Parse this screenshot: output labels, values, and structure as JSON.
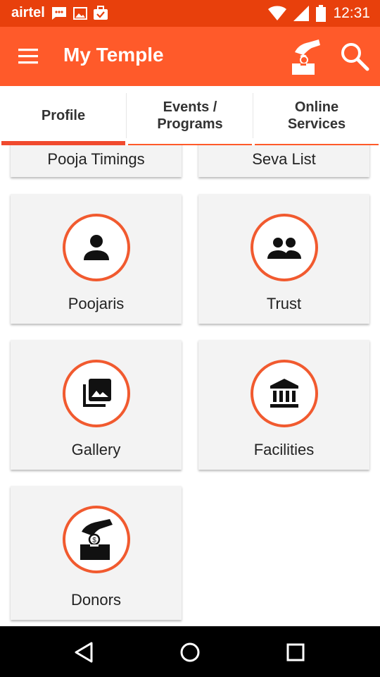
{
  "status_bar": {
    "carrier": "airtel",
    "time": "12:31",
    "icons": [
      "sms-icon",
      "image-icon",
      "briefcase-check-icon",
      "wifi-icon",
      "signal-icon",
      "battery-icon"
    ]
  },
  "app_bar": {
    "title": "My Temple",
    "icons": [
      "menu-icon",
      "donate-icon",
      "search-icon"
    ]
  },
  "tabs": [
    {
      "label_line1": "Profile",
      "label_line2": "",
      "active": true
    },
    {
      "label_line1": "Events /",
      "label_line2": "Programs",
      "active": false
    },
    {
      "label_line1": "Online",
      "label_line2": "Services",
      "active": false
    }
  ],
  "cards": [
    {
      "label": "Pooja Timings",
      "icon": ""
    },
    {
      "label": "Seva List",
      "icon": ""
    },
    {
      "label": "Poojaris",
      "icon": "person-icon"
    },
    {
      "label": "Trust",
      "icon": "people-icon"
    },
    {
      "label": "Gallery",
      "icon": "photo-library-icon"
    },
    {
      "label": "Facilities",
      "icon": "bank-icon"
    },
    {
      "label": "Donors",
      "icon": "donation-box-icon"
    }
  ],
  "colors": {
    "status_bar": "#E8400C",
    "app_bar": "#FF5A2A",
    "accent": "#F15A2F",
    "card": "#F3F3F3"
  }
}
